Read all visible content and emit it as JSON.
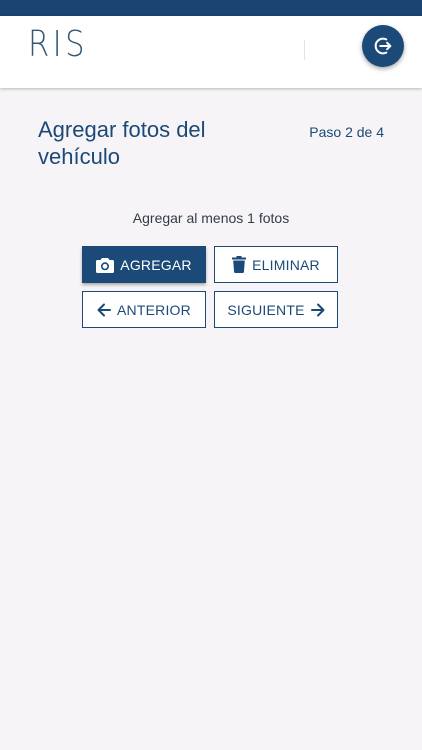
{
  "header": {
    "logo_text": "RIS",
    "logout_icon": "logout-icon"
  },
  "colors": {
    "primary": "#1c4a78",
    "status_bar": "#1c4472",
    "background": "#f6f4f6"
  },
  "page": {
    "title": "Agregar fotos del vehículo",
    "step": "Paso 2 de 4",
    "instruction": "Agregar al menos 1 fotos"
  },
  "actions": {
    "add_label": "AGREGAR",
    "add_icon": "camera-icon",
    "delete_label": "ELIMINAR",
    "delete_icon": "trash-icon",
    "prev_label": "ANTERIOR",
    "prev_icon": "arrow-left-icon",
    "next_label": "SIGUIENTE",
    "next_icon": "arrow-right-icon"
  }
}
